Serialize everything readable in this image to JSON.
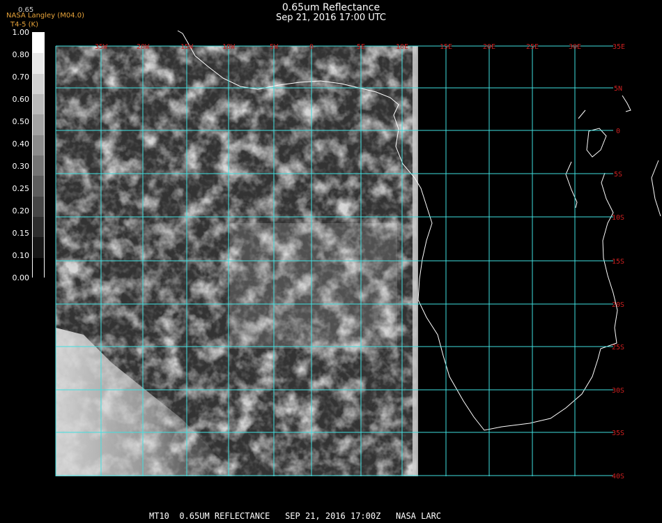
{
  "header": {
    "title": "0.65um Reflectance",
    "datetime": "Sep 21, 2016 17:00 UTC"
  },
  "credits": {
    "channel_tag": "0.65",
    "producer": "NASA Langley (M04.0)",
    "bands": "T4-5 (K)"
  },
  "colorbar": {
    "labels": [
      "1.00",
      "0.80",
      "0.70",
      "0.60",
      "0.50",
      "0.40",
      "0.30",
      "0.25",
      "0.20",
      "0.15",
      "0.10",
      "0.00"
    ]
  },
  "map": {
    "longitude_labels": [
      "35W",
      "20W",
      "15W",
      "10W",
      "5W",
      "0",
      "5E",
      "10E",
      "15E",
      "20E",
      "25E",
      "30E",
      "35E"
    ],
    "latitude_labels": [
      "5N",
      "0",
      "5S",
      "10S",
      "15S",
      "20S",
      "25S",
      "30S",
      "35S",
      "40S"
    ],
    "grid_color": "#40e0e0",
    "label_color": "#cc2020"
  },
  "footer": {
    "text": "MT10  0.65UM REFLECTANCE   SEP 21, 2016 17:00Z   NASA LARC"
  }
}
